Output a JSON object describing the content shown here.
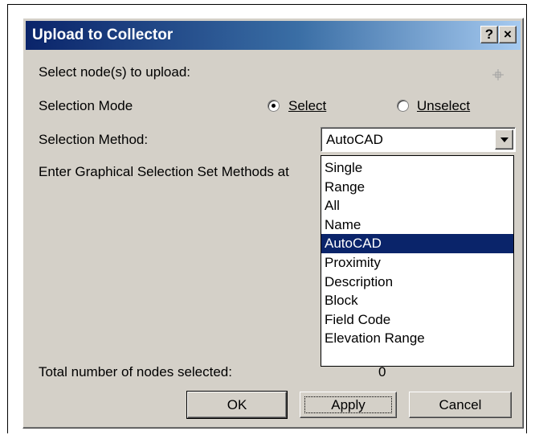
{
  "window": {
    "title": "Upload to Collector",
    "help_button": "?",
    "close_button": "×"
  },
  "labels": {
    "select_nodes": "Select node(s) to upload:",
    "selection_mode": "Selection Mode",
    "selection_method": "Selection Method:",
    "graphical_hint": "Enter Graphical Selection Set Methods at",
    "total_nodes": "Total number of nodes selected:",
    "total_count": "0"
  },
  "radio": {
    "select_label": "Select",
    "unselect_label": "Unselect",
    "selected": "Select"
  },
  "selection_method": {
    "value": "AutoCAD",
    "options": [
      "Single",
      "Range",
      "All",
      "Name",
      "AutoCAD",
      "Proximity",
      "Description",
      "Block",
      "Field Code",
      "Elevation Range"
    ],
    "highlighted": "AutoCAD"
  },
  "buttons": {
    "ok": "OK",
    "apply": "Apply",
    "cancel": "Cancel"
  },
  "colors": {
    "title_start": "#0a246a",
    "title_end": "#a6caf0",
    "face": "#d4d0c8",
    "highlight": "#0a246a"
  },
  "icons": {
    "pick": "crosshair-icon"
  }
}
